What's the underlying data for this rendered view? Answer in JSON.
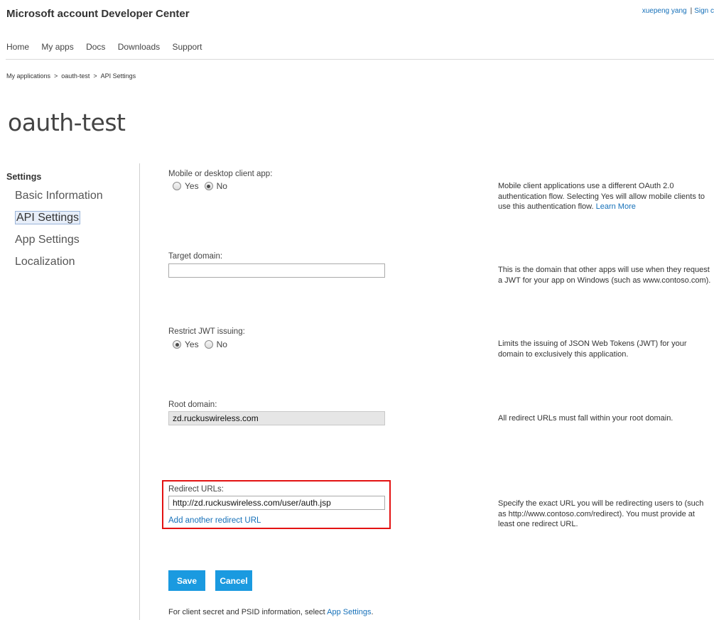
{
  "header": {
    "site_title": "Microsoft account Developer Center",
    "user_name": "xuepeng yang",
    "separator": "|",
    "sign_link": "Sign c"
  },
  "nav": [
    "Home",
    "My apps",
    "Docs",
    "Downloads",
    "Support"
  ],
  "breadcrumb": {
    "items": [
      "My applications",
      "oauth-test",
      "API Settings"
    ],
    "separator": ">"
  },
  "page_title": "oauth-test",
  "sidebar": {
    "heading": "Settings",
    "items": [
      "Basic Information",
      "API Settings",
      "App Settings",
      "Localization"
    ],
    "active": "API Settings"
  },
  "form": {
    "mobile": {
      "label": "Mobile or desktop client app:",
      "yes": "Yes",
      "no": "No",
      "selected": "No",
      "help": "Mobile client applications use a different OAuth 2.0 authentication flow. Selecting Yes will allow mobile clients to use this authentication flow.",
      "help_link": "Learn More"
    },
    "target_domain": {
      "label": "Target domain:",
      "value": "",
      "help": "This is the domain that other apps will use when they request a JWT for your app on Windows (such as www.contoso.com)."
    },
    "restrict_jwt": {
      "label": "Restrict JWT issuing:",
      "yes": "Yes",
      "no": "No",
      "selected": "Yes",
      "help": "Limits the issuing of JSON Web Tokens (JWT) for your domain to exclusively this application."
    },
    "root_domain": {
      "label": "Root domain:",
      "value": "zd.ruckuswireless.com",
      "help": "All redirect URLs must fall within your root domain."
    },
    "redirect_urls": {
      "label": "Redirect URLs:",
      "value": "http://zd.ruckuswireless.com/user/auth.jsp",
      "add_link": "Add another redirect URL",
      "help": "Specify the exact URL you will be redirecting users to (such as http://www.contoso.com/redirect). You must provide at least one redirect URL.",
      "highlight_color": "#e31212"
    }
  },
  "buttons": {
    "save": "Save",
    "cancel": "Cancel"
  },
  "footer": {
    "text": "For client secret and PSID information, select",
    "link": "App Settings",
    "end": "."
  },
  "colors": {
    "accent": "#1a9ae0",
    "link": "#1570b9",
    "highlight": "#e31212"
  }
}
